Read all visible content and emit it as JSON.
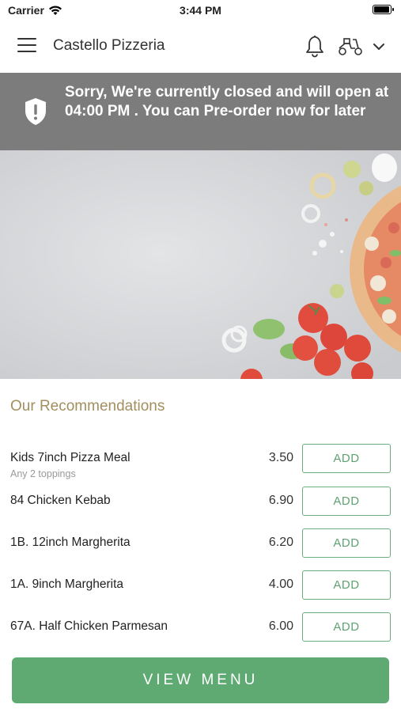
{
  "status_bar": {
    "carrier": "Carrier",
    "time": "3:44 PM",
    "battery_level": 1.0
  },
  "header": {
    "title": "Castello Pizzeria",
    "icons": [
      "hamburger-menu-icon",
      "bell-icon",
      "scooter-icon",
      "chevron-down-icon"
    ]
  },
  "banner": {
    "message": "Sorry, We're currently closed and will open at 04:00 PM . You can Pre-order now for later",
    "icon": "shield-alert-icon"
  },
  "recommendations": {
    "title": "Our Recommendations",
    "items": [
      {
        "name": "Kids 7inch Pizza Meal",
        "subtitle": "Any 2 toppings",
        "price": "3.50",
        "add_label": "ADD"
      },
      {
        "name": "84 Chicken Kebab",
        "subtitle": "",
        "price": "6.90",
        "add_label": "ADD"
      },
      {
        "name": "1B. 12inch Margherita",
        "subtitle": "",
        "price": "6.20",
        "add_label": "ADD"
      },
      {
        "name": "1A. 9inch Margherita",
        "subtitle": "",
        "price": "4.00",
        "add_label": "ADD"
      },
      {
        "name": "67A. Half Chicken Parmesan",
        "subtitle": "",
        "price": "6.00",
        "add_label": "ADD"
      }
    ]
  },
  "view_menu_label": "VIEW MENU",
  "colors": {
    "accent_green": "#5eaa72",
    "banner_gray": "#7c7c7c",
    "section_title_gold": "#a38f5e"
  }
}
